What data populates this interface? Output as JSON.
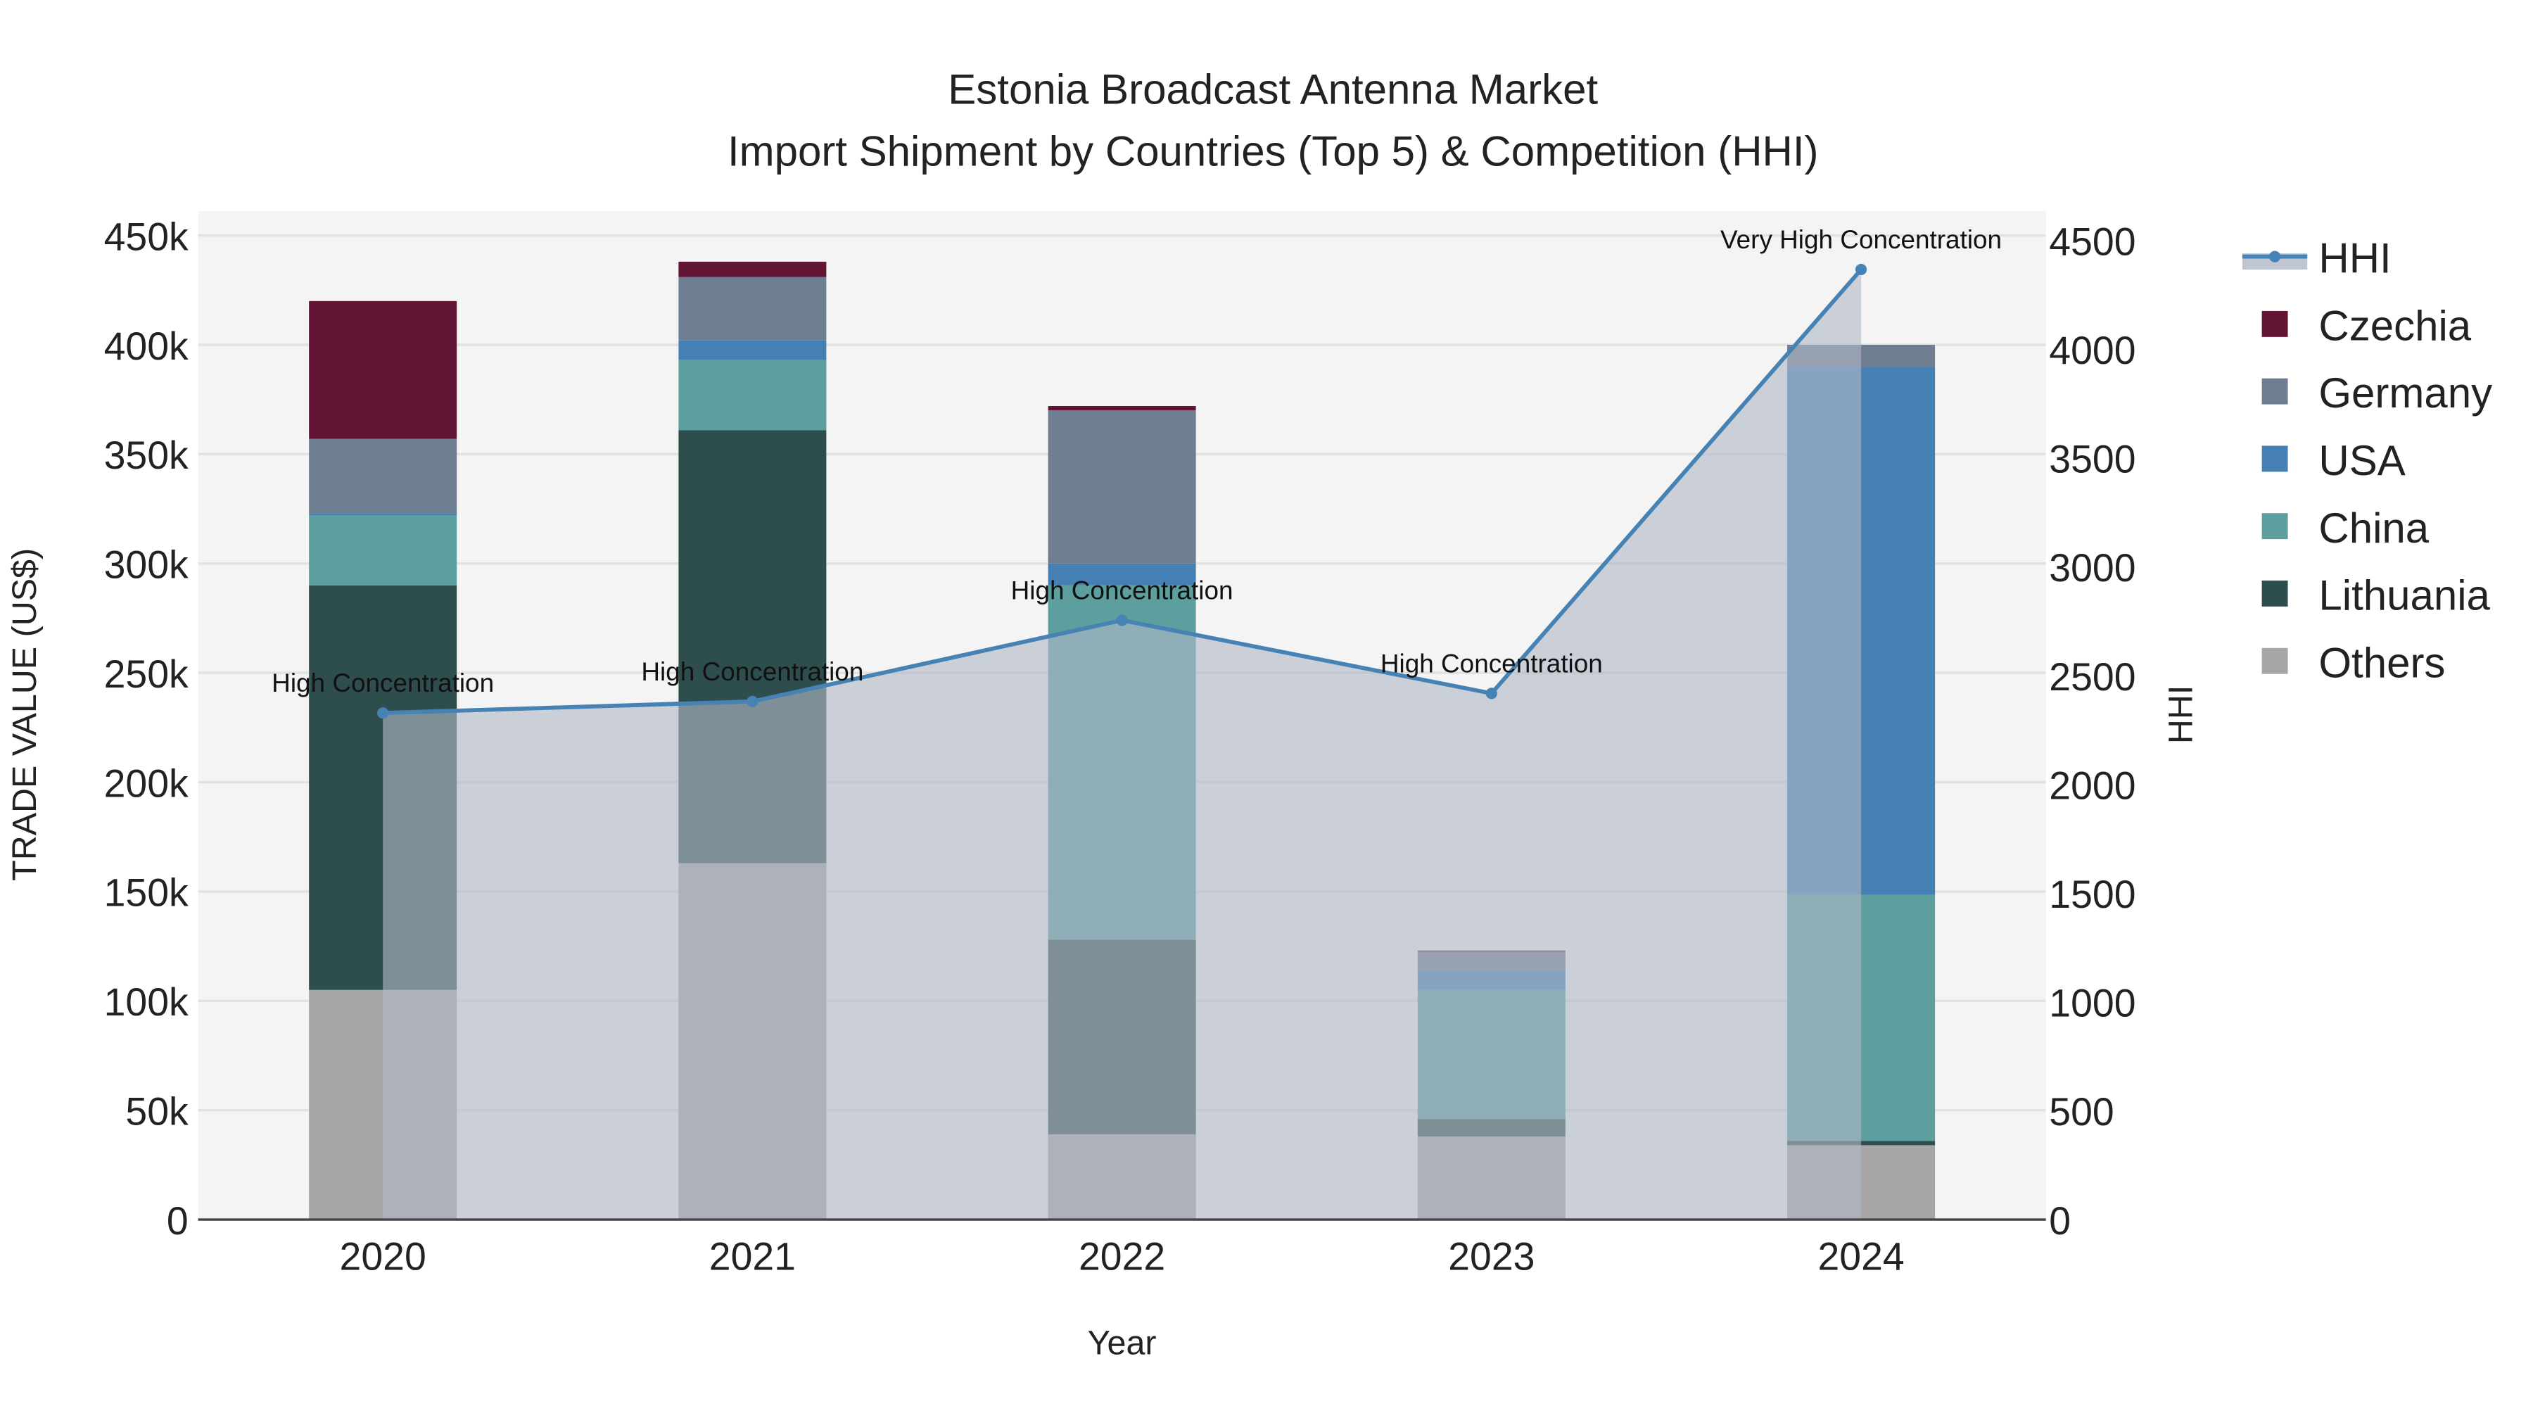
{
  "chart_data": {
    "type": "bar",
    "title": "Estonia Broadcast Antenna Market",
    "subtitle": "Import Shipment by Countries (Top 5) & Competition (HHI)",
    "xlabel": "Year",
    "ylabel": "TRADE VALUE (US$)",
    "y2label": "HHI",
    "categories": [
      "2020",
      "2021",
      "2022",
      "2023",
      "2024"
    ],
    "ylim": [
      0,
      450000
    ],
    "y2lim": [
      0,
      4500
    ],
    "yticks": [
      "0",
      "50k",
      "100k",
      "150k",
      "200k",
      "250k",
      "300k",
      "350k",
      "400k",
      "450k"
    ],
    "y2ticks": [
      "0",
      "500",
      "1000",
      "1500",
      "2000",
      "2500",
      "3000",
      "3500",
      "4000",
      "4500"
    ],
    "stacked": true,
    "series": [
      {
        "name": "Others",
        "color": "#a6a6a6",
        "values": [
          105000,
          163000,
          39000,
          38000,
          34000
        ]
      },
      {
        "name": "Lithuania",
        "color": "#2e4e4e",
        "values": [
          185000,
          198000,
          89000,
          8000,
          2000
        ]
      },
      {
        "name": "China",
        "color": "#5d9e9f",
        "values": [
          32000,
          32000,
          162000,
          59000,
          112500
        ]
      },
      {
        "name": "USA",
        "color": "#4580b5",
        "values": [
          1000,
          9000,
          10000,
          9000,
          241500
        ]
      },
      {
        "name": "Germany",
        "color": "#6e7d8f",
        "values": [
          34000,
          29000,
          70000,
          8500,
          10000
        ]
      },
      {
        "name": "Czechia",
        "color": "#611434",
        "values": [
          63000,
          7000,
          2000,
          500,
          0
        ]
      }
    ],
    "hhi": {
      "name": "HHI",
      "color": "#4682b4",
      "values": [
        2328,
        2381,
        2754,
        2418,
        4366
      ],
      "annotations": [
        "High Concentration",
        "High Concentration",
        "High Concentration",
        "High Concentration",
        "Very High Concentration"
      ]
    },
    "legend": [
      "HHI",
      "Czechia",
      "Germany",
      "USA",
      "China",
      "Lithuania",
      "Others"
    ],
    "legend_position": "right",
    "grid": true
  }
}
